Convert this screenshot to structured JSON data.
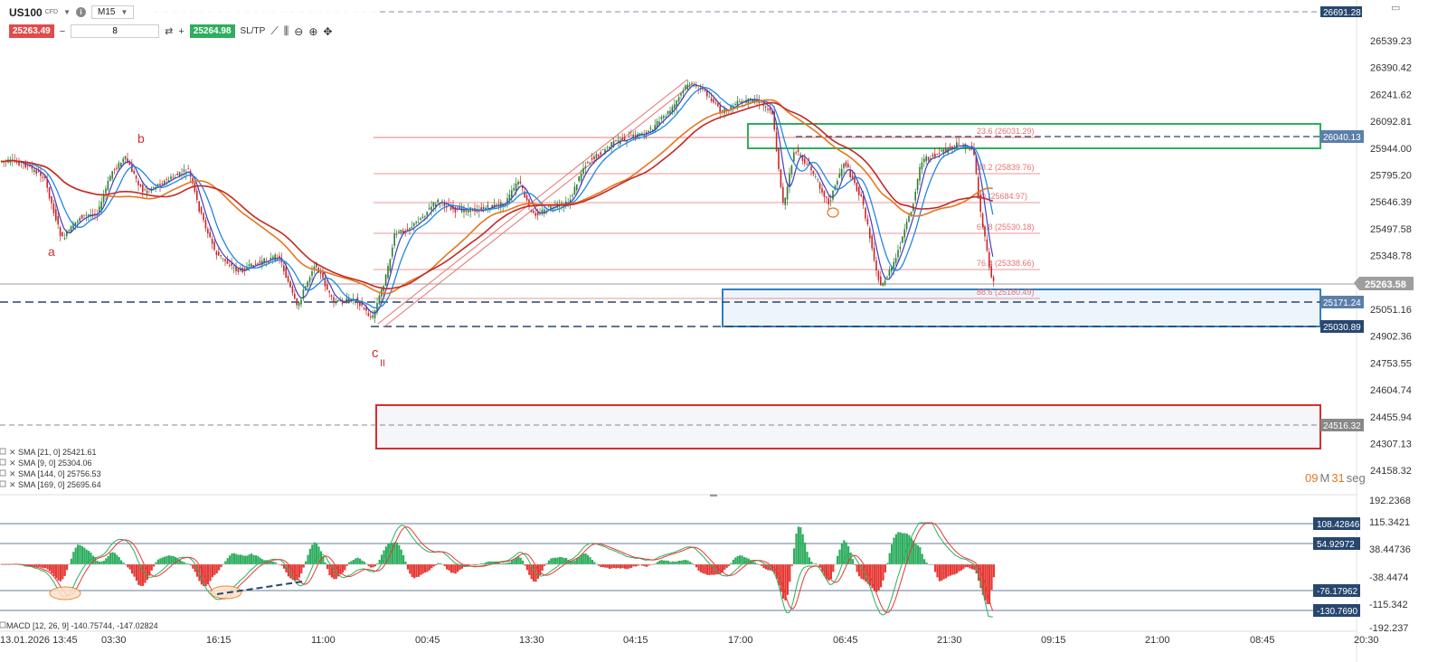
{
  "toolbar": {
    "symbol": "US100",
    "symbol_type": "CFD",
    "info_icon": "info-icon",
    "timeframe": "M15",
    "sell_price": "25263.49",
    "buy_price": "25264.98",
    "quantity": "8",
    "minus": "−",
    "plus": "+",
    "sltp_label": "SL/TP",
    "icons": [
      "line-tool-icon",
      "bar-style-icon",
      "zoom-out-icon",
      "zoom-in-icon",
      "crosshair-icon"
    ]
  },
  "price_axis": {
    "labels": [
      "26539.23",
      "26390.42",
      "26241.62",
      "26092.81",
      "25944.00",
      "25795.20",
      "25646.39",
      "25497.58",
      "25348.78",
      "25199.97",
      "25051.16",
      "24902.36",
      "24753.55",
      "24604.74",
      "24455.94",
      "24307.13",
      "24158.32"
    ],
    "current_price": "25263.58",
    "top_hidden_label": "26691.28"
  },
  "price_tags": [
    {
      "label": "26040.13",
      "color": "#5b7fa8"
    },
    {
      "label": "25171.24",
      "color": "#5b7fa8"
    },
    {
      "label": "25030.89",
      "color": "#27476f"
    },
    {
      "label": "24516.32",
      "color": "#888888"
    }
  ],
  "macd_axis": {
    "labels": [
      "192.2368",
      "115.3421",
      "38.44736",
      "-38.4474",
      "-115.342",
      "-192.237"
    ]
  },
  "macd_tags": [
    {
      "label": "108.42846",
      "color": "#27476f"
    },
    {
      "label": "54.92972",
      "color": "#27476f"
    },
    {
      "label": "-76.17962",
      "color": "#27476f"
    },
    {
      "label": "-130.7690",
      "color": "#27476f"
    }
  ],
  "time_axis": {
    "labels": [
      "13.01.2026 13:45",
      "03:30",
      "16:15",
      "11:00",
      "00:45",
      "13:30",
      "04:15",
      "17:00",
      "06:45",
      "21:30",
      "09:15",
      "21:00",
      "08:45",
      "20:30"
    ]
  },
  "legend": [
    {
      "label": "SMA [21, 0] 25421.61",
      "color": "#1e88e5"
    },
    {
      "label": "SMA [9, 0] 25304.06",
      "color": "#3f3fbf"
    },
    {
      "label": "SMA [144, 0] 25756.53",
      "color": "#e6761e"
    },
    {
      "label": "SMA [169, 0] 25695.64",
      "color": "#c62828"
    }
  ],
  "macd_legend": "MACD [12, 26, 9] -140.75744, -147.02824",
  "wave_labels": [
    "a",
    "b",
    "c",
    "II"
  ],
  "fib_labels": [
    {
      "text": "23.6 (26031.29)"
    },
    {
      "text": "38.2 (25839.76)"
    },
    {
      "text": "50 (25684.97)"
    },
    {
      "text": "61.8 (25530.18)"
    },
    {
      "text": "76.4 (25338.66)"
    },
    {
      "text": "88.6 (25180.49)"
    }
  ],
  "countdown": {
    "minutes": "09",
    "m_unit": "M",
    "seconds": "31",
    "s_unit": "seg"
  },
  "colors": {
    "candle_up": "#2e7d32",
    "candle_down": "#c62828",
    "macd_pos": "#2eae5f",
    "macd_neg": "#e53935",
    "sma21": "#1e88e5",
    "sma9": "#3f3fbf",
    "sma144": "#e6761e",
    "sma169": "#c62828",
    "fib": "#e57373",
    "green_zone": "#2eae5f",
    "blue_zone": "#2f7fc1",
    "red_zone": "#d32f2f",
    "countdown": "#e6761e"
  }
}
